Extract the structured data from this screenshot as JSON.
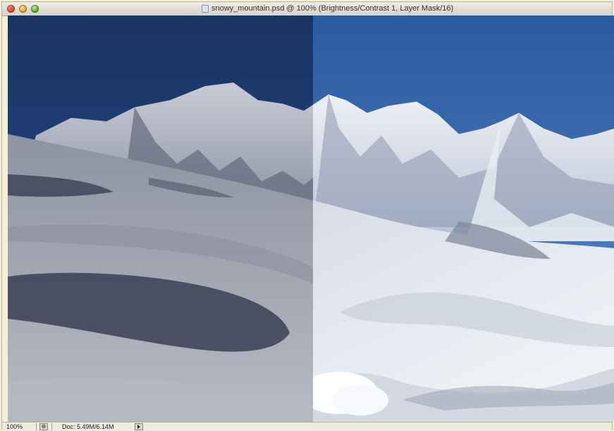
{
  "window": {
    "title": "snowy_mountain.psd @ 100% (Brightness/Contrast 1, Layer Mask/16)",
    "controls": [
      "close",
      "minimize",
      "zoom"
    ]
  },
  "statusbar": {
    "zoom": "100%",
    "doc_info": "Doc: 5.49M/6.14M"
  },
  "icons": {
    "close": "close-icon",
    "minimize": "minimize-icon",
    "zoom": "zoom-icon",
    "document": "document-icon",
    "status": "status-icon",
    "menu_arrow": "triangle-right-icon"
  },
  "colors": {
    "sky_left": "#1d3a6e",
    "sky_right": "#2b5fa8",
    "window_bg": "#f5f0dc",
    "snow_left": "#a9b0bd",
    "snow_right": "#e6ebf2"
  }
}
